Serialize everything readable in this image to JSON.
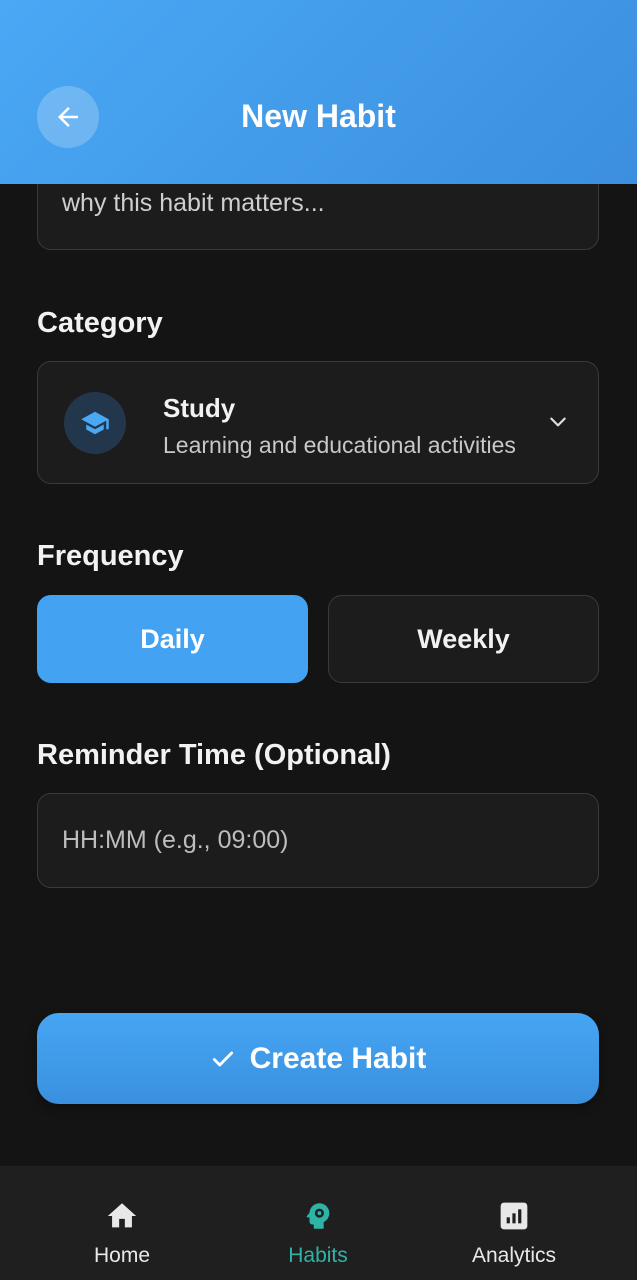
{
  "header": {
    "title": "New Habit",
    "back_icon": "arrow-left-icon"
  },
  "description": {
    "visible_text": "why this habit matters..."
  },
  "category": {
    "label": "Category",
    "selected": {
      "name": "Study",
      "description": "Learning and educational activities",
      "icon": "graduation-cap-icon"
    }
  },
  "frequency": {
    "label": "Frequency",
    "options": [
      "Daily",
      "Weekly"
    ],
    "selected": "Daily"
  },
  "reminder": {
    "label": "Reminder Time (Optional)",
    "placeholder": "HH:MM (e.g., 09:00)",
    "value": ""
  },
  "create_button": {
    "label": "Create Habit",
    "icon": "check-icon"
  },
  "nav": {
    "items": [
      {
        "label": "Home",
        "icon": "home-icon"
      },
      {
        "label": "Habits",
        "icon": "head-gear-icon"
      },
      {
        "label": "Analytics",
        "icon": "bar-chart-icon"
      }
    ],
    "active": "Habits"
  },
  "colors": {
    "accent": "#43a3f2",
    "nav_active": "#2fb3a6",
    "background": "#141414"
  }
}
